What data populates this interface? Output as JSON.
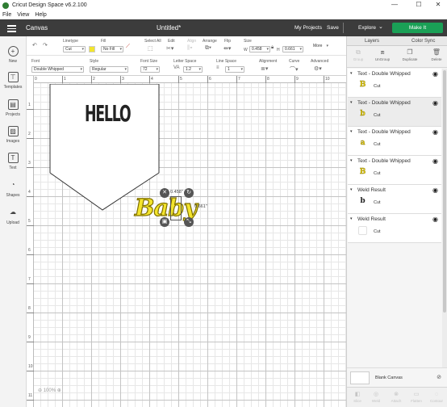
{
  "window": {
    "title": "Cricut Design Space  v6.2.100",
    "minimize": "—",
    "maximize": "☐",
    "close": "✕"
  },
  "menu": [
    "File",
    "View",
    "Help"
  ],
  "header": {
    "section": "Canvas",
    "doc_title": "Untitled*",
    "my_projects": "My Projects",
    "save": "Save",
    "explore": "Explore",
    "make_it": "Make It",
    "accent": "#1aa056"
  },
  "toolbar1": {
    "linetype_label": "Linetype",
    "linetype_value": "Cut",
    "fill_label": "Fill",
    "fill_value": "No Fill",
    "select_all_label": "Select All",
    "edit_label": "Edit",
    "align_label": "Align",
    "arrange_label": "Arrange",
    "flip_label": "Flip",
    "size_label": "Size",
    "width_prefix": "W",
    "width_value": "0.458",
    "height_prefix": "H",
    "height_value": "0.661",
    "more_label": "More"
  },
  "toolbar2": {
    "font_label": "Font",
    "font_value": "Double Whipped",
    "style_label": "Style",
    "style_value": "Regular",
    "font_size_label": "Font Size",
    "font_size_value": "72",
    "letter_space_label": "Letter Space",
    "letter_space_value": "1.2",
    "line_space_label": "Line Space",
    "line_space_value": "1",
    "alignment_label": "Alignment",
    "curve_label": "Curve",
    "advanced_label": "Advanced"
  },
  "leftnav": [
    {
      "label": "New",
      "icon": "plus-icon"
    },
    {
      "label": "Templates",
      "icon": "shirt-icon"
    },
    {
      "label": "Projects",
      "icon": "projects-icon"
    },
    {
      "label": "Images",
      "icon": "image-icon"
    },
    {
      "label": "Text",
      "icon": "text-icon"
    },
    {
      "label": "Shapes",
      "icon": "shapes-icon"
    },
    {
      "label": "Upload",
      "icon": "upload-icon"
    }
  ],
  "rulers": {
    "top": [
      "0",
      "1",
      "2",
      "3",
      "4",
      "5",
      "6",
      "7",
      "8",
      "9",
      "10"
    ],
    "left": [
      "1",
      "2",
      "3",
      "4",
      "5",
      "6",
      "7",
      "8",
      "9",
      "10",
      "11"
    ]
  },
  "canvas": {
    "hello_text": "HELLO",
    "baby_text": "Baby",
    "width_readout": "0.458\"",
    "height_readout": "0.661\"",
    "zoom": "100%"
  },
  "rightpanel": {
    "tab_layers": "Layers",
    "tab_color_sync": "Color Sync",
    "tools": [
      {
        "label": "Group",
        "enabled": false
      },
      {
        "label": "UnGroup",
        "enabled": true
      },
      {
        "label": "Duplicate",
        "enabled": true
      },
      {
        "label": "Delete",
        "enabled": true
      }
    ],
    "layers": [
      {
        "title": "Text - Double Whipped",
        "child": "Cut",
        "glyph": "B",
        "selected": false
      },
      {
        "title": "Text - Double Whipped",
        "child": "Cut",
        "glyph": "b",
        "selected": true
      },
      {
        "title": "Text - Double Whipped",
        "child": "Cut",
        "glyph": "a",
        "selected": false
      },
      {
        "title": "Text - Double Whipped",
        "child": "Cut",
        "glyph": "B",
        "selected": false
      },
      {
        "title": "Weld Result",
        "child": "Cut",
        "glyph": "b",
        "selected": false
      },
      {
        "title": "Weld Result",
        "child": "Cut",
        "glyph": "",
        "selected": false
      }
    ],
    "blank_canvas": "Blank Canvas",
    "bottom_tools": [
      "Slice",
      "Weld",
      "Attach",
      "Flatten",
      "Contour"
    ]
  }
}
